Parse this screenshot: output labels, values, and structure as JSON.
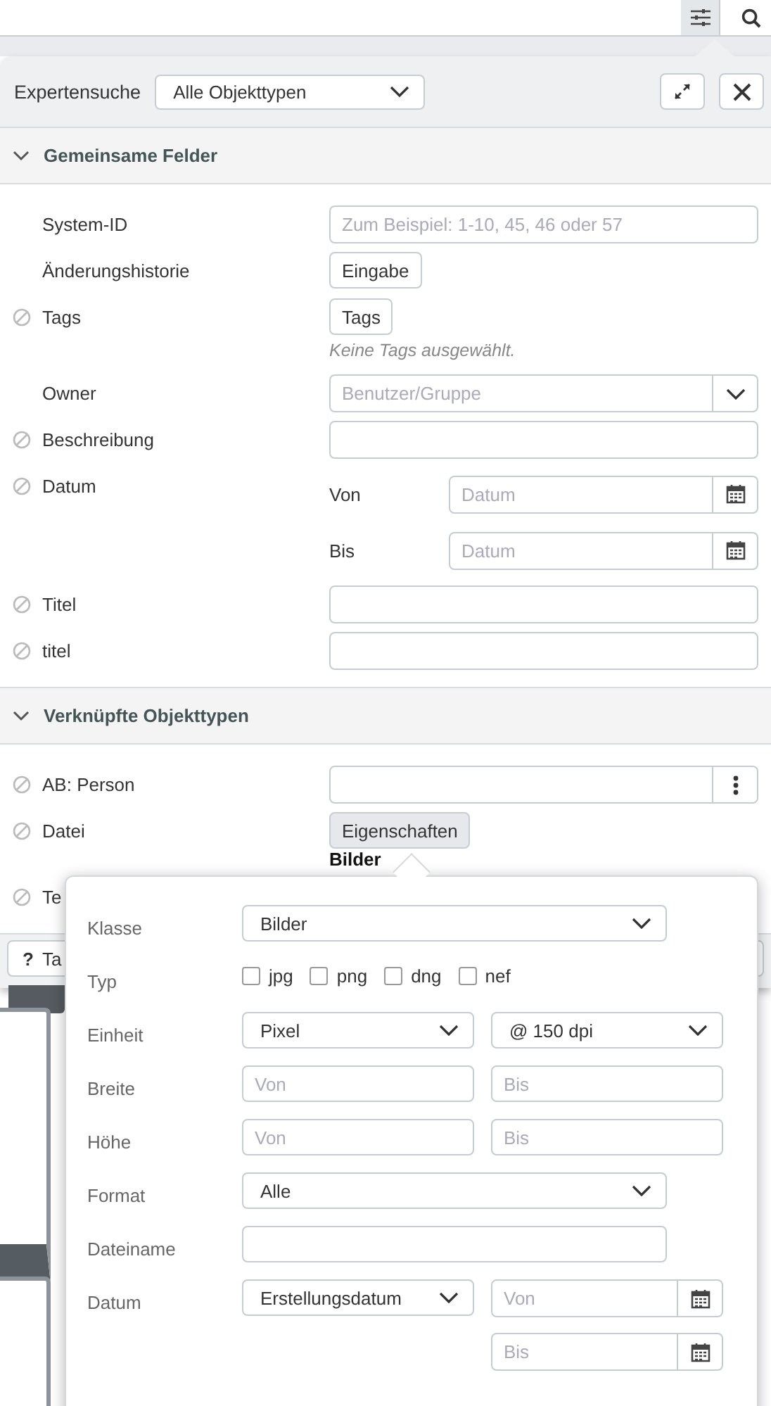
{
  "toolbar": {
    "buttons": [
      {
        "kind": "filter",
        "selected": true
      },
      {
        "kind": "search",
        "selected": false
      }
    ]
  },
  "header": {
    "title": "Expertensuche",
    "object_type": "Alle Objekttypen"
  },
  "sections": [
    {
      "title": "Gemeinsame Felder",
      "expanded": true,
      "fields": [
        {
          "label": "System-ID",
          "restricted": false,
          "kind": "text",
          "placeholder": "Zum Beispiel: 1-10, 45, 46 oder 57"
        },
        {
          "label": "Änderungshistorie",
          "restricted": false,
          "kind": "button",
          "button": "Eingabe"
        },
        {
          "label": "Tags",
          "restricted": true,
          "kind": "tags",
          "button": "Tags",
          "note": "Keine Tags ausgewählt."
        },
        {
          "label": "Owner",
          "restricted": false,
          "kind": "picker",
          "placeholder": "Benutzer/Gruppe"
        },
        {
          "label": "Beschreibung",
          "restricted": true,
          "kind": "text"
        },
        {
          "label": "Datum",
          "restricted": true,
          "kind": "daterange",
          "from_label": "Von",
          "from_placeholder": "Datum",
          "to_label": "Bis",
          "to_placeholder": "Datum"
        },
        {
          "label": "Titel",
          "restricted": true,
          "kind": "text"
        },
        {
          "label": "titel",
          "restricted": true,
          "kind": "text"
        }
      ]
    },
    {
      "title": "Verknüpfte Objekttypen",
      "expanded": true,
      "fields": [
        {
          "label": "AB: Person",
          "restricted": true,
          "kind": "menu-input"
        },
        {
          "label": "Datei",
          "restricted": true,
          "kind": "properties",
          "button": "Eigenschaften",
          "value": "Bilder"
        },
        {
          "label": "Te",
          "restricted": true,
          "kind": "hidden"
        }
      ]
    }
  ],
  "bottom_button": {
    "icon": "?",
    "label": "Ta"
  },
  "popover": {
    "rows": [
      {
        "label": "Klasse",
        "kind": "select",
        "value": "Bilder"
      },
      {
        "label": "Typ",
        "kind": "checkboxes",
        "options": [
          {
            "label": "jpg",
            "checked": false
          },
          {
            "label": "png",
            "checked": false
          },
          {
            "label": "dng",
            "checked": false
          },
          {
            "label": "nef",
            "checked": false
          }
        ]
      },
      {
        "label": "Einheit",
        "kind": "select-pair",
        "values": [
          "Pixel",
          "@ 150 dpi"
        ]
      },
      {
        "label": "Breite",
        "kind": "range",
        "placeholders": [
          "Von",
          "Bis"
        ]
      },
      {
        "label": "Höhe",
        "kind": "range",
        "placeholders": [
          "Von",
          "Bis"
        ]
      },
      {
        "label": "Format",
        "kind": "select",
        "value": "Alle"
      },
      {
        "label": "Dateiname",
        "kind": "text"
      },
      {
        "label": "Datum",
        "kind": "date-range",
        "value": "Erstellungsdatum",
        "placeholders": [
          "Von",
          "Bis"
        ]
      }
    ]
  }
}
